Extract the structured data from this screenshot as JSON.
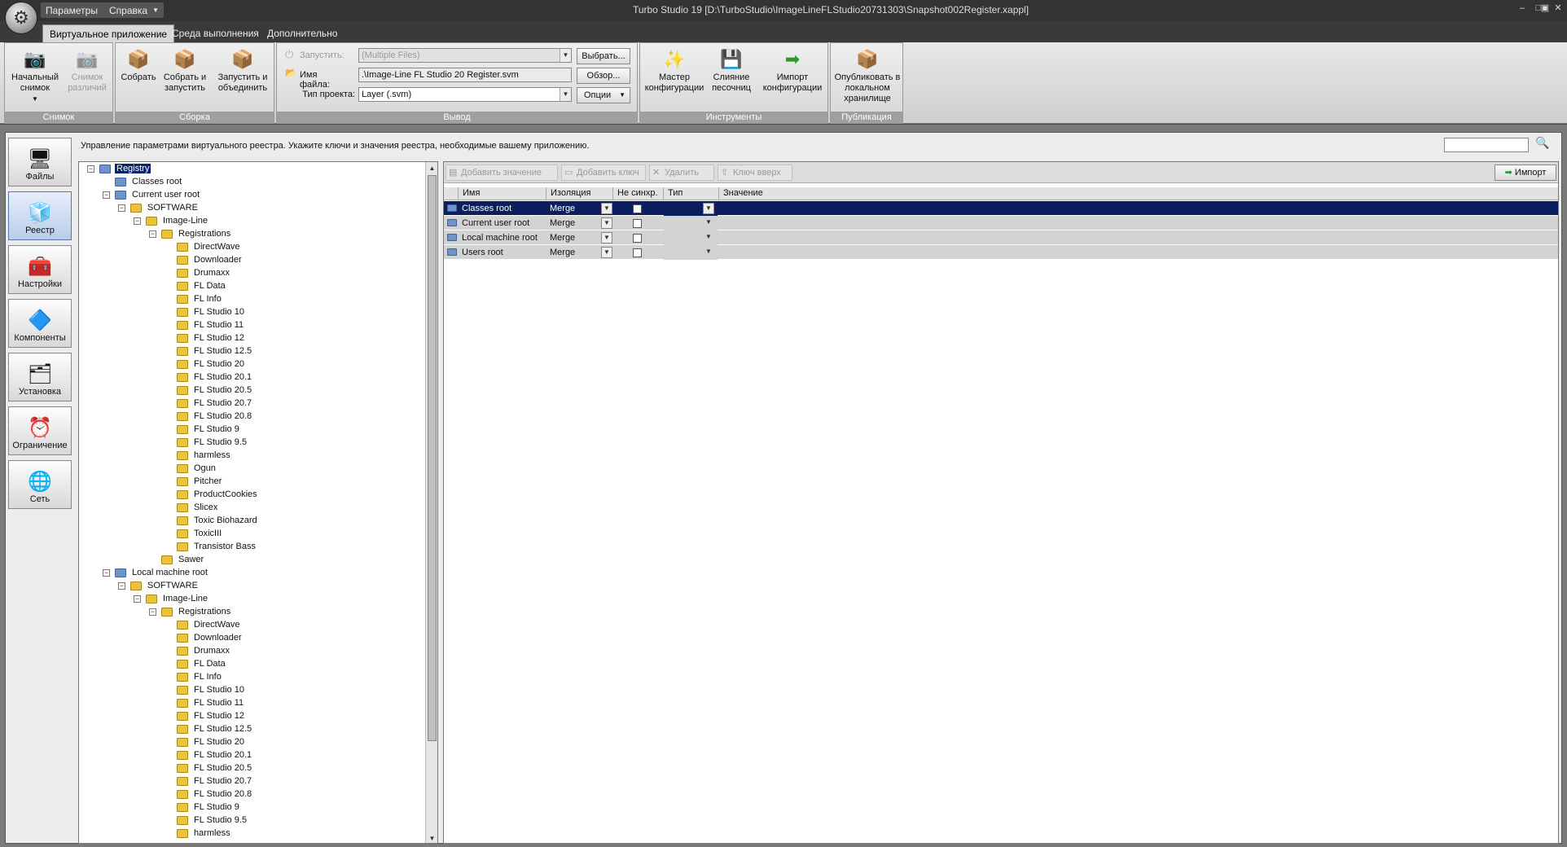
{
  "titlebar": {
    "title": "Turbo Studio 19 [D:\\TurboStudio\\ImageLineFLStudio20731303\\Snapshot002Register.xappl]",
    "menus": [
      "Параметры",
      "Справка"
    ],
    "controls": [
      "‒",
      "□",
      "▣",
      "✕"
    ]
  },
  "tabs": [
    "Виртуальное приложение",
    "Среда выполнения",
    "Дополнительно"
  ],
  "ribbon": {
    "groups": {
      "snapshot": "Снимок",
      "build": "Сборка",
      "output": "Вывод",
      "tools": "Инструменты",
      "publish": "Публикация"
    },
    "snapshot_buttons": [
      "Начальный снимок",
      "Снимок различий"
    ],
    "build_buttons": [
      "Собрать",
      "Собрать и запустить",
      "Запустить и объединить"
    ],
    "output": {
      "run_label": "Запустить:",
      "run_value": "(Multiple Files)",
      "file_label": "Имя файла:",
      "file_value": ".\\Image-Line FL Studio 20 Register.svm",
      "type_label": "Тип проекта:",
      "type_value": "Layer (.svm)",
      "select_btn": "Выбрать...",
      "browse_btn": "Обзор...",
      "options_btn": "Опции"
    },
    "tools_buttons": [
      "Мастер конфигурации",
      "Слияние песочниц",
      "Импорт конфигурации"
    ],
    "publish_buttons": [
      "Опубликовать в локальном хранилище"
    ]
  },
  "sidebar": [
    "Файлы",
    "Реестр",
    "Настройки",
    "Компоненты",
    "Установка",
    "Ограничение",
    "Сеть"
  ],
  "description": "Управление параметрами виртуального реестра. Укажите ключи и значения реестра, необходимые вашему приложению.",
  "tree": [
    {
      "label": "Registry",
      "level": 0,
      "exp": "minus",
      "icon": "b",
      "selected": true
    },
    {
      "label": "Classes root",
      "level": 1,
      "exp": "",
      "icon": "b"
    },
    {
      "label": "Current user root",
      "level": 1,
      "exp": "minus",
      "icon": "b"
    },
    {
      "label": "SOFTWARE",
      "level": 2,
      "exp": "minus",
      "icon": "y"
    },
    {
      "label": "Image-Line",
      "level": 3,
      "exp": "minus",
      "icon": "y"
    },
    {
      "label": "Registrations",
      "level": 4,
      "exp": "minus",
      "icon": "y"
    },
    {
      "label": "DirectWave",
      "level": 5,
      "exp": "",
      "icon": "y"
    },
    {
      "label": "Downloader",
      "level": 5,
      "exp": "",
      "icon": "y"
    },
    {
      "label": "Drumaxx",
      "level": 5,
      "exp": "",
      "icon": "y"
    },
    {
      "label": "FL Data",
      "level": 5,
      "exp": "",
      "icon": "y"
    },
    {
      "label": "FL Info",
      "level": 5,
      "exp": "",
      "icon": "y"
    },
    {
      "label": "FL Studio 10",
      "level": 5,
      "exp": "",
      "icon": "y"
    },
    {
      "label": "FL Studio 11",
      "level": 5,
      "exp": "",
      "icon": "y"
    },
    {
      "label": "FL Studio 12",
      "level": 5,
      "exp": "",
      "icon": "y"
    },
    {
      "label": "FL Studio 12.5",
      "level": 5,
      "exp": "",
      "icon": "y"
    },
    {
      "label": "FL Studio 20",
      "level": 5,
      "exp": "",
      "icon": "y"
    },
    {
      "label": "FL Studio 20.1",
      "level": 5,
      "exp": "",
      "icon": "y"
    },
    {
      "label": "FL Studio 20.5",
      "level": 5,
      "exp": "",
      "icon": "y"
    },
    {
      "label": "FL Studio 20.7",
      "level": 5,
      "exp": "",
      "icon": "y"
    },
    {
      "label": "FL Studio 20.8",
      "level": 5,
      "exp": "",
      "icon": "y"
    },
    {
      "label": "FL Studio 9",
      "level": 5,
      "exp": "",
      "icon": "y"
    },
    {
      "label": "FL Studio 9.5",
      "level": 5,
      "exp": "",
      "icon": "y"
    },
    {
      "label": "harmless",
      "level": 5,
      "exp": "",
      "icon": "y"
    },
    {
      "label": "Ogun",
      "level": 5,
      "exp": "",
      "icon": "y"
    },
    {
      "label": "Pitcher",
      "level": 5,
      "exp": "",
      "icon": "y"
    },
    {
      "label": "ProductCookies",
      "level": 5,
      "exp": "",
      "icon": "y"
    },
    {
      "label": "Slicex",
      "level": 5,
      "exp": "",
      "icon": "y"
    },
    {
      "label": "Toxic Biohazard",
      "level": 5,
      "exp": "",
      "icon": "y"
    },
    {
      "label": "ToxicIII",
      "level": 5,
      "exp": "",
      "icon": "y"
    },
    {
      "label": "Transistor Bass",
      "level": 5,
      "exp": "",
      "icon": "y"
    },
    {
      "label": "Sawer",
      "level": 4,
      "exp": "",
      "icon": "y"
    },
    {
      "label": "Local machine root",
      "level": 1,
      "exp": "minus",
      "icon": "b"
    },
    {
      "label": "SOFTWARE",
      "level": 2,
      "exp": "minus",
      "icon": "y"
    },
    {
      "label": "Image-Line",
      "level": 3,
      "exp": "minus",
      "icon": "y"
    },
    {
      "label": "Registrations",
      "level": 4,
      "exp": "minus",
      "icon": "y"
    },
    {
      "label": "DirectWave",
      "level": 5,
      "exp": "",
      "icon": "y"
    },
    {
      "label": "Downloader",
      "level": 5,
      "exp": "",
      "icon": "y"
    },
    {
      "label": "Drumaxx",
      "level": 5,
      "exp": "",
      "icon": "y"
    },
    {
      "label": "FL Data",
      "level": 5,
      "exp": "",
      "icon": "y"
    },
    {
      "label": "FL Info",
      "level": 5,
      "exp": "",
      "icon": "y"
    },
    {
      "label": "FL Studio 10",
      "level": 5,
      "exp": "",
      "icon": "y"
    },
    {
      "label": "FL Studio 11",
      "level": 5,
      "exp": "",
      "icon": "y"
    },
    {
      "label": "FL Studio 12",
      "level": 5,
      "exp": "",
      "icon": "y"
    },
    {
      "label": "FL Studio 12.5",
      "level": 5,
      "exp": "",
      "icon": "y"
    },
    {
      "label": "FL Studio 20",
      "level": 5,
      "exp": "",
      "icon": "y"
    },
    {
      "label": "FL Studio 20.1",
      "level": 5,
      "exp": "",
      "icon": "y"
    },
    {
      "label": "FL Studio 20.5",
      "level": 5,
      "exp": "",
      "icon": "y"
    },
    {
      "label": "FL Studio 20.7",
      "level": 5,
      "exp": "",
      "icon": "y"
    },
    {
      "label": "FL Studio 20.8",
      "level": 5,
      "exp": "",
      "icon": "y"
    },
    {
      "label": "FL Studio 9",
      "level": 5,
      "exp": "",
      "icon": "y"
    },
    {
      "label": "FL Studio 9.5",
      "level": 5,
      "exp": "",
      "icon": "y"
    },
    {
      "label": "harmless",
      "level": 5,
      "exp": "",
      "icon": "y"
    }
  ],
  "toolbar": {
    "add_value": "Добавить значение",
    "add_key": "Добавить ключ",
    "delete": "Удалить",
    "key_up": "Ключ вверх",
    "import": "Импорт"
  },
  "grid": {
    "headers": [
      "Имя",
      "Изоляция",
      "Не синхр.",
      "Тип",
      "Значение"
    ],
    "rows": [
      {
        "name": "Classes root",
        "isolation": "Merge",
        "checked": false,
        "selected": true
      },
      {
        "name": "Current user root",
        "isolation": "Merge",
        "checked": false,
        "selected": false
      },
      {
        "name": "Local machine root",
        "isolation": "Merge",
        "checked": false,
        "selected": false
      },
      {
        "name": "Users root",
        "isolation": "Merge",
        "checked": false,
        "selected": false
      }
    ]
  },
  "colors": {
    "selection": "#0b1f5e",
    "ribbon_label": "#9f9f9f",
    "titlebar": "#333333"
  }
}
